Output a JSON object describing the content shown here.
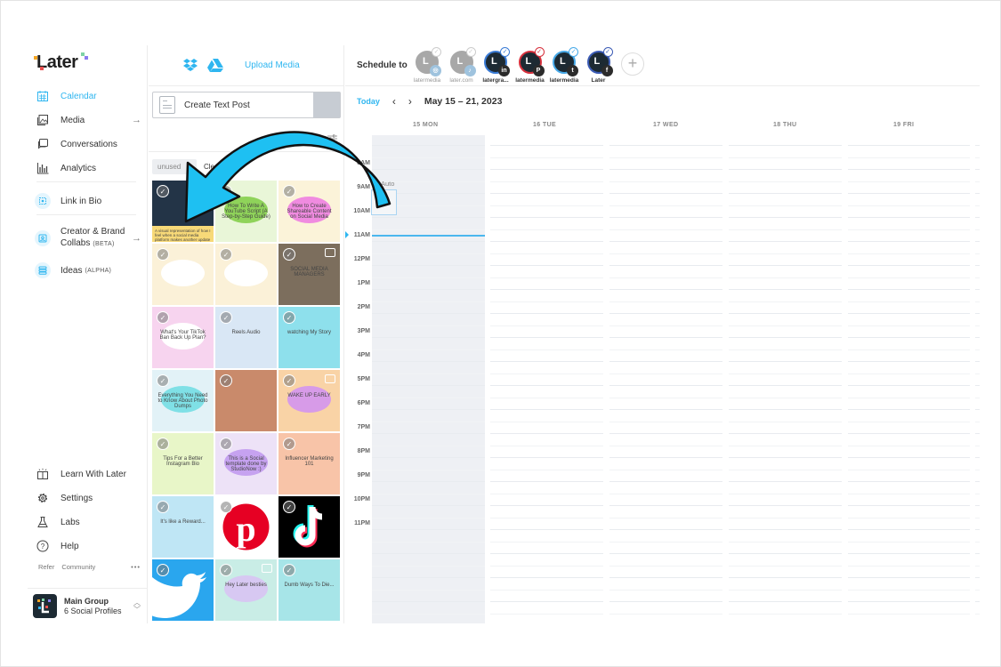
{
  "sidebar": {
    "logo": "Later",
    "items": [
      {
        "label": "Calendar",
        "icon": "calendar-icon",
        "active": true
      },
      {
        "label": "Media",
        "icon": "media-icon",
        "arrow": "→"
      },
      {
        "label": "Conversations",
        "icon": "conversations-icon"
      },
      {
        "label": "Analytics",
        "icon": "analytics-icon"
      },
      {
        "label": "Link in Bio",
        "icon": "link-in-bio-icon"
      },
      {
        "label": "Creator & Brand",
        "label2": "Collabs",
        "tag": "(BETA)",
        "icon": "collabs-icon",
        "arrow": "→"
      },
      {
        "label": "Ideas",
        "tag": "(ALPHA)",
        "icon": "ideas-icon"
      }
    ],
    "bottom_items": [
      {
        "label": "Learn With Later",
        "icon": "book-icon"
      },
      {
        "label": "Settings",
        "icon": "gear-icon"
      },
      {
        "label": "Labs",
        "icon": "flask-icon"
      },
      {
        "label": "Help",
        "icon": "help-icon"
      }
    ],
    "footer_links": {
      "refer": "Refer",
      "community": "Community",
      "more": "•••"
    },
    "group": {
      "name": "Main Group",
      "profiles": "6 Social Profiles"
    }
  },
  "media_panel": {
    "upload_label": "Upload Media",
    "sources": [
      "dropbox-icon",
      "google-drive-icon"
    ],
    "create_post": "Create Text Post",
    "show_filters": "Show Filters",
    "filter_chip": "unused",
    "clear_all": "Clear All",
    "tiles": [
      {
        "kind": "photo",
        "bg": "#233447",
        "caption": "A visual representation of how I feel when a social media platform makes another update"
      },
      {
        "kind": "graphic",
        "bg": "#e9f6d8",
        "blob": "#8fd35a",
        "text": "How To Write A YouTube Script (A Step-by-Step Guide)"
      },
      {
        "kind": "graphic",
        "bg": "#fbf3d9",
        "blob": "#f08be0",
        "text": "How to Create Shareable Content on Social Media"
      },
      {
        "kind": "graphic",
        "bg": "#fbf1d8",
        "blob": "#ffffff",
        "text": ""
      },
      {
        "kind": "graphic",
        "bg": "#fbf1d8",
        "blob": "#ffffff",
        "text": ""
      },
      {
        "kind": "video",
        "bg": "#7c6e5d",
        "text": "SOCIAL MEDIA MANAGERS"
      },
      {
        "kind": "graphic",
        "bg": "#f7d4ef",
        "blob": "#ffffff",
        "text": "What's Your TikTok Ban Back Up Plan?"
      },
      {
        "kind": "graphic",
        "bg": "#d9e7f5",
        "blob": "",
        "text": "Reels Audio"
      },
      {
        "kind": "photo",
        "bg": "#8ee0ec",
        "text": "watching My Story"
      },
      {
        "kind": "graphic",
        "bg": "#e2f2f7",
        "blob": "#7fe0e6",
        "text": "Everything You Need to Know About Photo Dumps"
      },
      {
        "kind": "photo",
        "bg": "#c98a6b",
        "text": ""
      },
      {
        "kind": "video",
        "bg": "#f9d3a6",
        "blob": "#d79be8",
        "text": "WAKE UP EARLY"
      },
      {
        "kind": "graphic",
        "bg": "#e8f6c8",
        "blob": "",
        "text": "Tips For a Better Instagram Bio"
      },
      {
        "kind": "graphic",
        "bg": "#ede2f7",
        "blob": "#c6a2f0",
        "text": "This is a Social template done by StudioNow :)"
      },
      {
        "kind": "graphic",
        "bg": "#f8c4a8",
        "blob": "",
        "text": "Influencer Marketing 101"
      },
      {
        "kind": "photo",
        "bg": "#bfe6f5",
        "text": "It's like a Reward..."
      },
      {
        "kind": "logo",
        "bg": "#ffffff",
        "logo": "pinterest"
      },
      {
        "kind": "logo",
        "bg": "#000000",
        "logo": "tiktok"
      },
      {
        "kind": "logo",
        "bg": "#2aa6ee",
        "logo": "twitter"
      },
      {
        "kind": "video",
        "bg": "#c9ede6",
        "blob": "#d7c8f2",
        "text": "Hey Later besties"
      },
      {
        "kind": "photo",
        "bg": "#a7e5e8",
        "text": "Dumb Ways To Die..."
      }
    ]
  },
  "calendar": {
    "schedule_to": "Schedule to",
    "profiles": [
      {
        "name": "latermedia",
        "network": "instagram",
        "glyph": "◎",
        "selected": false,
        "ring": "#a8a8a8"
      },
      {
        "name": "later.com",
        "network": "tiktok",
        "glyph": "♪",
        "selected": false,
        "ring": "#a8a8a8"
      },
      {
        "name": "latergra...",
        "network": "linkedin",
        "glyph": "in",
        "selected": true,
        "ring": "#3a7bd5"
      },
      {
        "name": "latermedia",
        "network": "pinterest",
        "glyph": "P",
        "selected": true,
        "ring": "#d6303c"
      },
      {
        "name": "latermedia",
        "network": "twitter",
        "glyph": "t",
        "selected": true,
        "ring": "#47a9e8"
      },
      {
        "name": "Later",
        "network": "facebook",
        "glyph": "f",
        "selected": true,
        "ring": "#3b5bb5"
      }
    ],
    "today_label": "Today",
    "prev": "‹",
    "next": "›",
    "date_range": "May 15 – 21, 2023",
    "days": [
      "15 MON",
      "16 TUE",
      "17 WED",
      "18 THU",
      "19 FRI"
    ],
    "hours": [
      "8AM",
      "9AM",
      "10AM",
      "11AM",
      "12PM",
      "1PM",
      "2PM",
      "3PM",
      "4PM",
      "5PM",
      "6PM",
      "7PM",
      "8PM",
      "9PM",
      "10PM",
      "11PM"
    ],
    "auto_label": "Auto",
    "accent": "#2fb6f0"
  },
  "overlay": {
    "arrow_color": "#1ec0f2"
  }
}
